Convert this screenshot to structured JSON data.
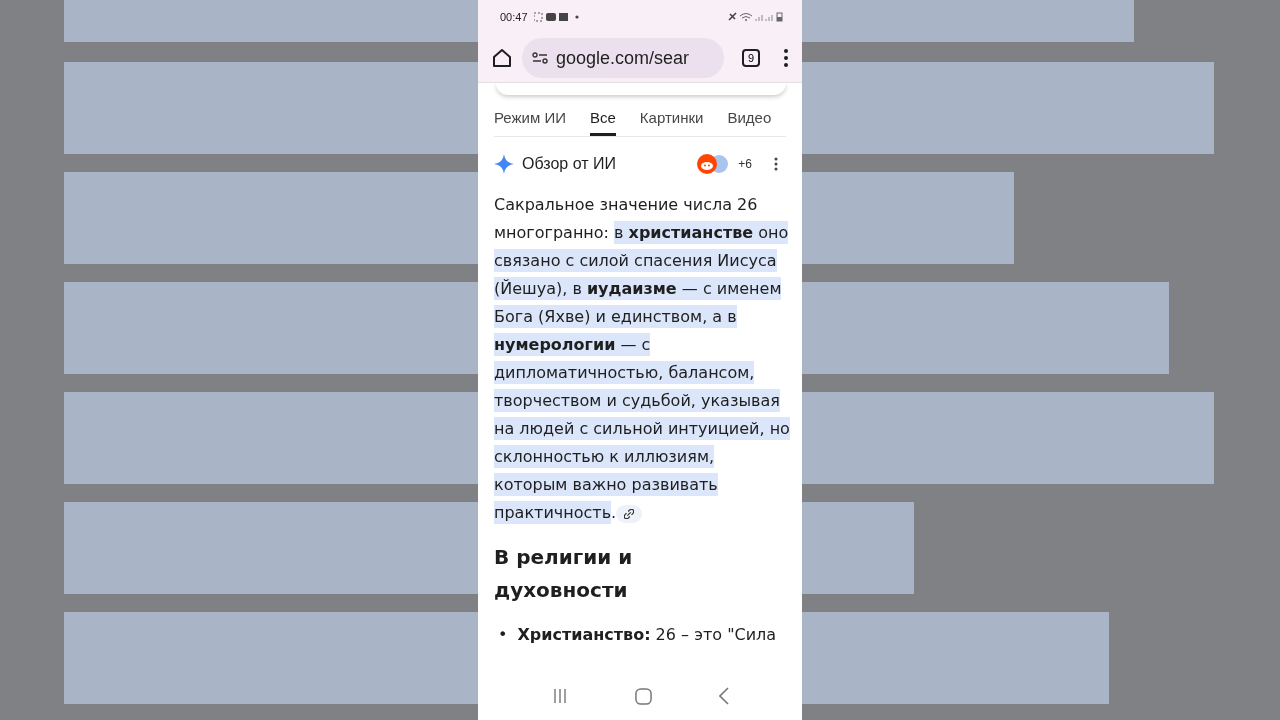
{
  "status_bar": {
    "time": "00:47"
  },
  "address_bar": {
    "url": "google.com/sear",
    "tab_count": "9"
  },
  "tabs": [
    {
      "label": "Режим ИИ",
      "selected": false
    },
    {
      "label": "Все",
      "selected": true
    },
    {
      "label": "Картинки",
      "selected": false
    },
    {
      "label": "Видео",
      "selected": false
    }
  ],
  "ai_overview": {
    "title": "Обзор от ИИ",
    "sources_more": "+6",
    "intro": "Сакральное значение числа 26 многогранно: ",
    "highlighted": "в **христианстве** оно связано с силой спасения Иисуса (Йешуа), в **иудаизме** — с именем Бога (Яхве) и единством, а в **нумерологии** — с дипломатичностью, балансом, творчеством и судьбой, указывая на людей с сильной интуицией, но склонностью к иллюзиям, которым важно развивать практичность",
    "end": ".",
    "heading": "В религии и духовности",
    "bullets": [
      {
        "marker": "•",
        "text": "**Христианство:** 26 – это \"Сила"
      }
    ]
  }
}
